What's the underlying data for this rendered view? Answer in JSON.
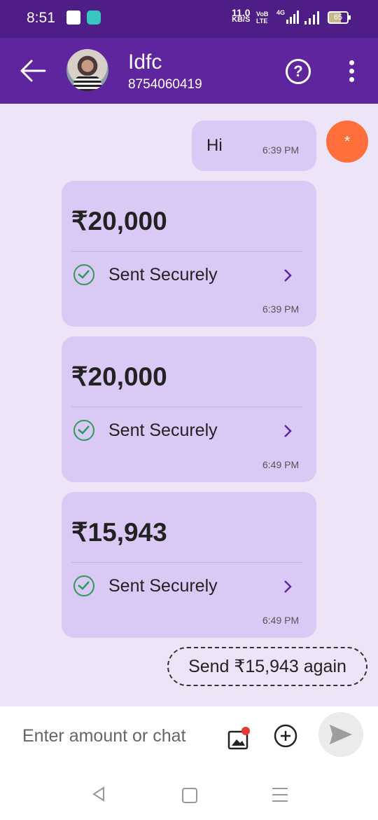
{
  "status_bar": {
    "time": "8:51",
    "speed_value": "11.0",
    "speed_unit": "KB/S",
    "volte_top": "VoB",
    "volte_bottom": "LTE",
    "network": "4G",
    "battery": "65"
  },
  "header": {
    "contact_name": "Idfc",
    "contact_number": "8754060419",
    "help_icon": "?"
  },
  "messages": {
    "hi": {
      "text": "Hi",
      "time": "6:39 PM"
    },
    "orange_badge": "*"
  },
  "payments": [
    {
      "amount": "₹20,000",
      "status": "Sent Securely",
      "time": "6:39 PM"
    },
    {
      "amount": "₹20,000",
      "status": "Sent Securely",
      "time": "6:49 PM"
    },
    {
      "amount": "₹15,943",
      "status": "Sent Securely",
      "time": "6:49 PM"
    }
  ],
  "send_again_label": "Send ₹15,943 again",
  "input": {
    "placeholder": "Enter amount or chat"
  },
  "colors": {
    "primary": "#5f259f",
    "bubble": "#dac8f5",
    "background": "#ede4f7",
    "check": "#2e9a57",
    "accent_orange": "#ff6f3c"
  }
}
